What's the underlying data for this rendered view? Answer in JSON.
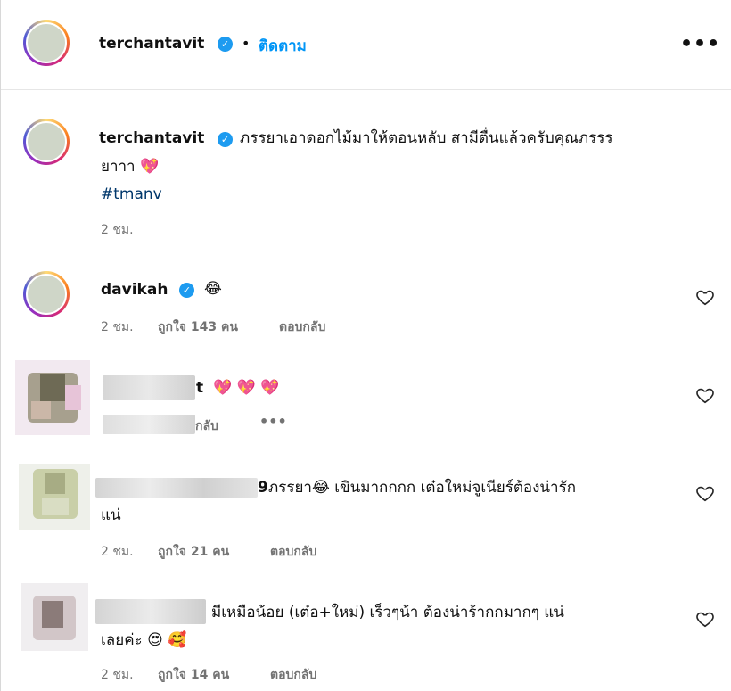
{
  "header": {
    "username": "terchantavit",
    "separator": "•",
    "follow_label": "ติดตาม",
    "more_label": "•••"
  },
  "caption": {
    "username": "terchantavit",
    "line1": "ภรรยาเอาดอกไม้มาให้ตอนหลับ สามีตื่นแล้วครับคุณภรรร",
    "line2": "ยาาา",
    "emoji": "💖",
    "hashtag": "#tmanv",
    "time": "2 ชม."
  },
  "comments": [
    {
      "username": "davikah",
      "text": "😂",
      "time": "2 ชม.",
      "likes": "ถูกใจ 143 คน",
      "reply": "ตอบกลับ"
    },
    {
      "username_visible": "t",
      "text": "💖 💖 💖",
      "meta_visible": "กลับ",
      "more": "•••"
    },
    {
      "username_visible": "9",
      "line1": "ภรรยา😂 เขินมากกกก เต๋อใหม่จูเนียร์ต้องน่ารัก",
      "line2": "แน่",
      "time": "2 ชม.",
      "likes": "ถูกใจ 21 คน",
      "reply": "ตอบกลับ"
    },
    {
      "line1": "มีเหมือน้อย (เต๋อ+ใหม่) เร็วๆน้า ต้องน่าร้ากกมากๆ แน่",
      "line2": "เลยค่ะ 😍 🥰",
      "time": "2 ชม.",
      "likes": "ถูกใจ 14 คน",
      "reply": "ตอบกลับ"
    }
  ],
  "colors": {
    "link_blue": "#0095f6",
    "hashtag_blue": "#00376b",
    "verified_blue": "#1d9bf0",
    "meta_gray": "#737373"
  },
  "icons": [
    "verified-badge-icon",
    "more-options-icon",
    "heart-outline-icon"
  ]
}
